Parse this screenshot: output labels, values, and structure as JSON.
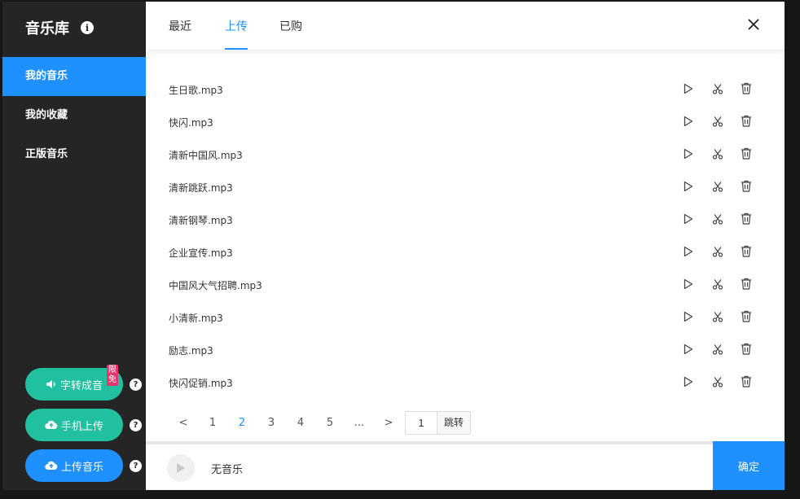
{
  "sidebar": {
    "title": "音乐库",
    "info_icon": "ⅰ",
    "items": [
      {
        "label": "我的音乐",
        "active": true
      },
      {
        "label": "我的收藏",
        "active": false
      },
      {
        "label": "正版音乐",
        "active": false
      }
    ],
    "buttons": {
      "tts": {
        "label": "字转成音",
        "badge": "限免",
        "help": "?"
      },
      "mobile_upload": {
        "label": "手机上传",
        "help": "?"
      },
      "upload_music": {
        "label": "上传音乐",
        "help": "?"
      }
    }
  },
  "tabs": [
    {
      "label": "最近",
      "active": false
    },
    {
      "label": "上传",
      "active": true
    },
    {
      "label": "已购",
      "active": false
    }
  ],
  "files": [
    "生日歌.mp3",
    "快闪.mp3",
    "清新中国风.mp3",
    "清新跳跃.mp3",
    "清新钢琴.mp3",
    "企业宣传.mp3",
    "中国风大气招聘.mp3",
    "小清新.mp3",
    "励志.mp3",
    "快闪促销.mp3"
  ],
  "pagination": {
    "prev": "<",
    "pages": [
      "1",
      "2",
      "3",
      "4",
      "5"
    ],
    "current": "2",
    "ellipsis": "...",
    "next": ">",
    "jump_value": "1",
    "jump_label": "跳转"
  },
  "footer": {
    "status": "无音乐",
    "confirm_label": "确定"
  },
  "colors": {
    "accent": "#1e90ff",
    "teal": "#20c0a0",
    "badge": "#e8336d",
    "sidebar_bg": "#252525"
  }
}
